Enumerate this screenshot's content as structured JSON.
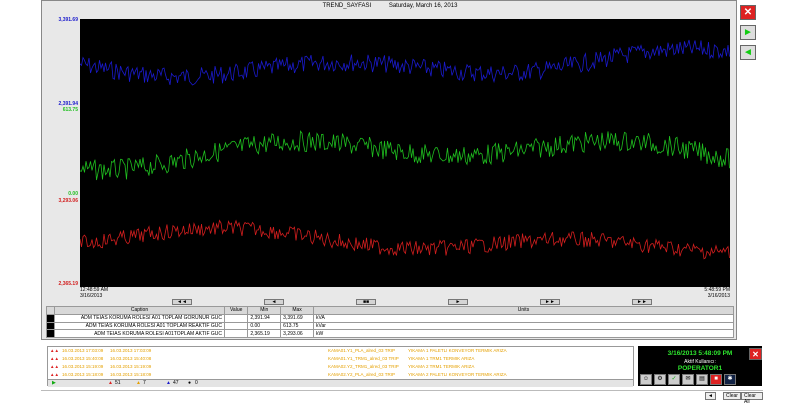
{
  "window": {
    "title": "TREND_SAYFASI",
    "date": "Saturday, March 16, 2013"
  },
  "axis": {
    "series1_top": "3,391.69",
    "series1_bottom": "2,391.94",
    "series2_top": "613.75",
    "series2_bottom": "0.00",
    "series3_top": "3,293.06",
    "series3_bottom": "2,365.19"
  },
  "time": {
    "start_time": "12:48:59 AM",
    "start_date": "3/16/2013",
    "end_time": "5:48:59 PM",
    "end_date": "3/16/2013"
  },
  "nav": [
    "◄◄",
    "◄",
    "■■",
    "►",
    "►►",
    "►►"
  ],
  "table": {
    "headers": [
      "Caption",
      "Value",
      "Min",
      "Max",
      "Units"
    ],
    "rows": [
      {
        "caption": "ADM TEIAS KORUMA ROLESI A01 TOPLAM GORUNUR GUC",
        "value": "",
        "min": "2,391.94",
        "max": "3,391.69",
        "units": "kVA"
      },
      {
        "caption": "ADM TEIAS KORUMA ROLESI A01 TOPLAM REAKTIF GUC",
        "value": "",
        "min": "0.00",
        "max": "613.75",
        "units": "kVar"
      },
      {
        "caption": "ADM TEIAS KORUMA ROLESI A01TOPLAM AKTIF GUC",
        "value": "",
        "min": "2,365.19",
        "max": "3,293.06",
        "units": "kW"
      }
    ]
  },
  "side_buttons": {
    "close": "✕",
    "next": "►",
    "prev": "◄"
  },
  "alarms": [
    {
      "date1": "16.03.2013 17:03:09",
      "date2": "16.03.2013 17:03:09",
      "tag": "KAMA01.Y1_PLA_alred_03 TRIP",
      "desc": "YIKAMA 1 PALETLI KONVEYOR TERMIK ARIZA"
    },
    {
      "date1": "16.03.2013 15:40:08",
      "date2": "16.03.2013 15:40:08",
      "tag": "KAMA01.Y1_TRM1_alred_03 TRIP",
      "desc": "YIKAMA 1 TRM1 TERMIK ARIZA"
    },
    {
      "date1": "16.03.2013 15:19:09",
      "date2": "16.03.2013 15:19:09",
      "tag": "KAMA02.Y2_TRM1_alred_03 TRIP",
      "desc": "YIKAMA 2 TRM1 TERMIK ARIZA"
    },
    {
      "date1": "16.03.2013 15:18:09",
      "date2": "16.03.2013 15:18:09",
      "tag": "KAMA02.Y2_PLA_alred_03 TRIP",
      "desc": "YIKAMA 2 PALETLI KONVEYOR TERMIK ARIZA"
    }
  ],
  "alarm_status": {
    "count1": "51",
    "count2": "7",
    "count3": "47",
    "count4": "0"
  },
  "operator": {
    "datetime": "3/16/2013 5:48:09 PM",
    "label": "Aktif Kullanıcı:",
    "name": "POPERATOR1",
    "close": "✕"
  },
  "bottom": {
    "clear": "Clear",
    "clear_all": "Clear All"
  },
  "colors": {
    "series1": "#1a1acc",
    "series2": "#1fbf1f",
    "series3": "#d21e1e",
    "bg": "#000000"
  }
}
